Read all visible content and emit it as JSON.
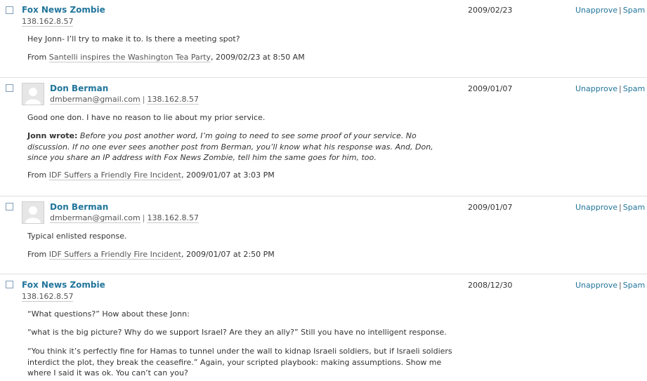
{
  "actions": {
    "unapprove": "Unapprove",
    "separator": "|",
    "spam": "Spam"
  },
  "comments": [
    {
      "author": "Fox News Zombie",
      "ip": "138.162.8.57",
      "date": "2009/02/23",
      "paragraphs": [
        "Hey Jonn- I’ll try to make it to. Is there a meeting spot?"
      ],
      "from_label": "From",
      "post": "Santelli inspires the Washington Tea Party",
      "timestamp": ", 2009/02/23 at 8:50 AM"
    },
    {
      "author": "Don Berman",
      "email": "dmberman@gmail.com",
      "meta_separator": "|",
      "ip": "138.162.8.57",
      "date": "2009/01/07",
      "paragraphs": [
        "Good one don. I have no reason to lie about my prior service."
      ],
      "quote_author": "Jonn wrote:",
      "quote_text": "Before you post another word, I’m going to need to see some proof of your service. No discussion. If no one ever sees another post from Berman, you’ll know what his response was. And, Don, since you share an IP address with Fox News Zombie, tell him the same goes for him, too.",
      "from_label": "From",
      "post": "IDF Suffers a Friendly Fire Incident",
      "timestamp": ", 2009/01/07 at 3:03 PM"
    },
    {
      "author": "Don Berman",
      "email": "dmberman@gmail.com",
      "meta_separator": "|",
      "ip": "138.162.8.57",
      "date": "2009/01/07",
      "paragraphs": [
        "Typical enlisted response."
      ],
      "from_label": "From",
      "post": "IDF Suffers a Friendly Fire Incident",
      "timestamp": ", 2009/01/07 at 2:50 PM"
    },
    {
      "author": "Fox News Zombie",
      "ip": "138.162.8.57",
      "date": "2008/12/30",
      "paragraphs": [
        "“What questions?” How about these Jonn:",
        "“what is the big picture? Why do we support Israel? Are they an ally?” Still you have no intelligent response.",
        "“You think it’s perfectly fine for Hamas to tunnel under the wall to kidnap Israeli soldiers, but if Israeli soldiers interdict the plot, they break the ceasefire.” Again, your scripted playbook: making assumptions. Show me where I said it was ok. You can’t can you?"
      ]
    }
  ]
}
